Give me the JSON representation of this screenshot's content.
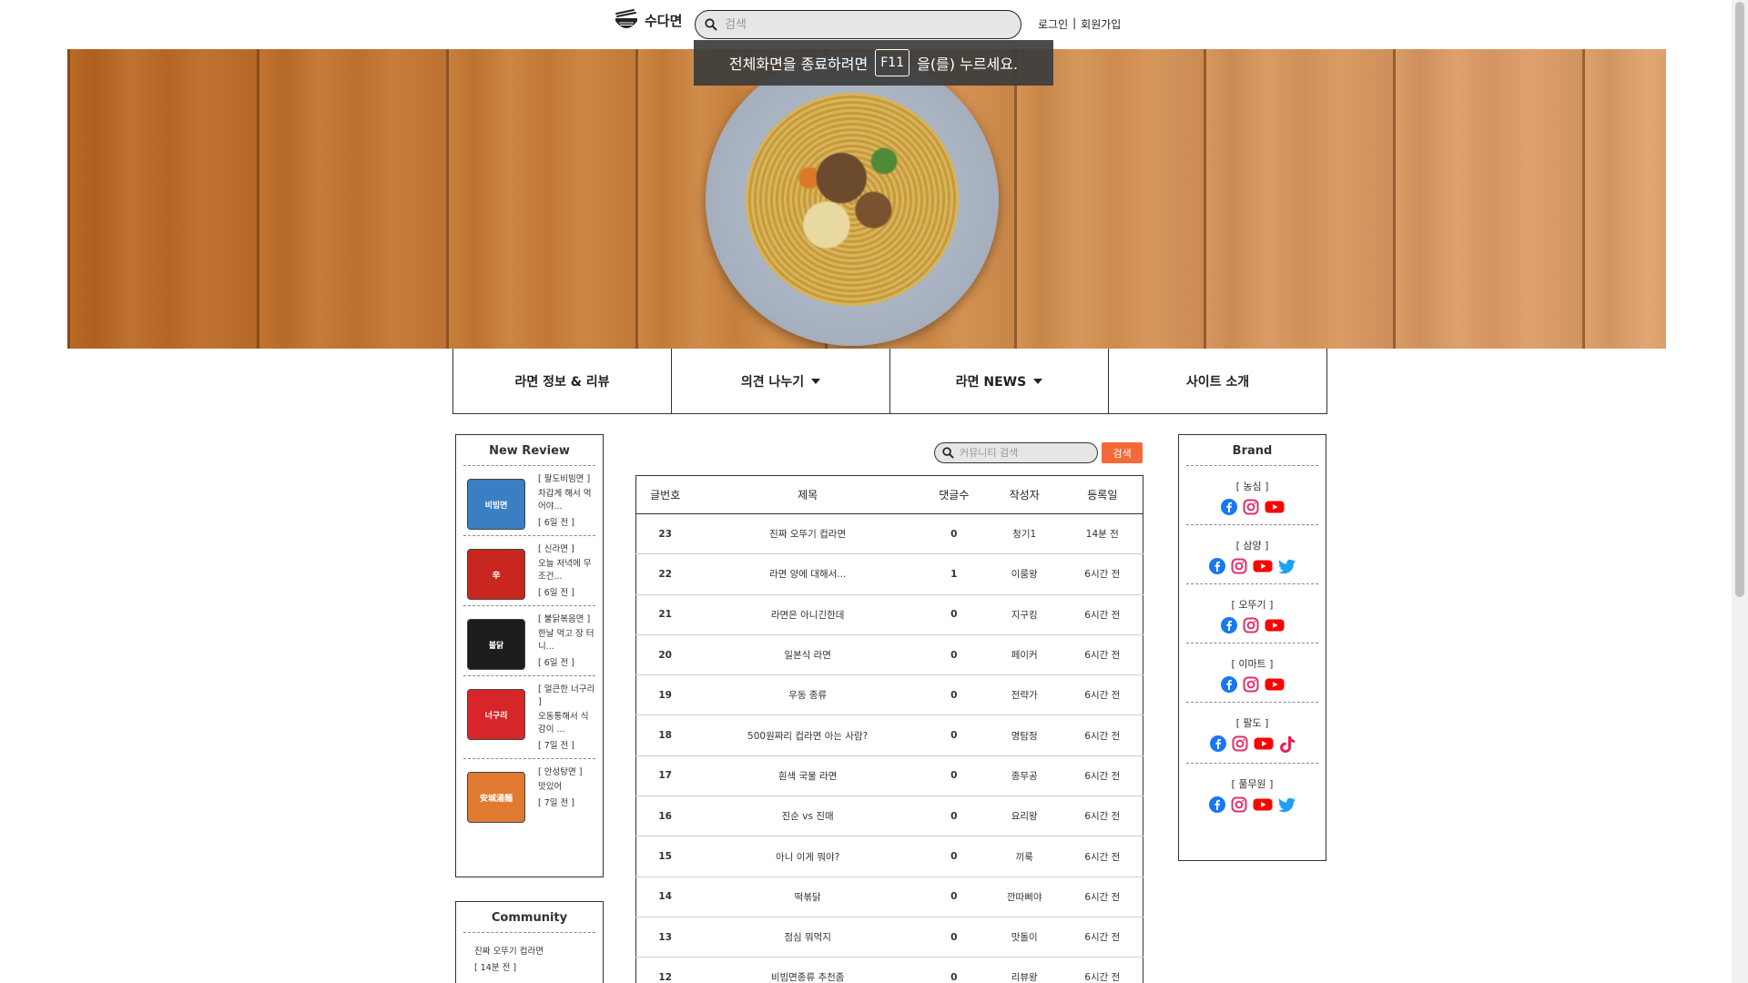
{
  "header": {
    "logo_text": "수다면",
    "search_placeholder": "검색",
    "login": "로그인",
    "separator": "|",
    "signup": "회원가입"
  },
  "toast": {
    "before": "전체화면을 종료하려면",
    "key": "F11",
    "after": "을(를) 누르세요."
  },
  "nav": [
    {
      "label": "라면 정보 & 리뷰",
      "dropdown": false
    },
    {
      "label": "의견 나누기",
      "dropdown": true
    },
    {
      "label": "라면 NEWS",
      "dropdown": true
    },
    {
      "label": "사이트 소개",
      "dropdown": false
    }
  ],
  "new_review": {
    "title": "New Review",
    "items": [
      {
        "product": "[ 팔도비빔면 ]",
        "comment": "차갑게 해서 먹어야...",
        "date": "[ 6일 전 ]",
        "thumb_color": "#3a7fc4",
        "thumb_text": "비빔면"
      },
      {
        "product": "[ 신라면 ]",
        "comment": "오늘 저녁에 무조건...",
        "date": "[ 6일 전 ]",
        "thumb_color": "#c8261e",
        "thumb_text": "辛"
      },
      {
        "product": "[ 불닭볶음면 ]",
        "comment": "한날 먹고 장 터니...",
        "date": "[ 6일 전 ]",
        "thumb_color": "#1c1c1c",
        "thumb_text": "불닭"
      },
      {
        "product": "[ 얼큰한 너구리 ]",
        "comment": "오동통해서 식감이 ...",
        "date": "[ 7일 전 ]",
        "thumb_color": "#d6262a",
        "thumb_text": "너구리"
      },
      {
        "product": "[ 안성탕면 ]",
        "comment": "맛있어",
        "date": "[ 7일 전 ]",
        "thumb_color": "#e07a30",
        "thumb_text": "安城湯麵"
      }
    ]
  },
  "community": {
    "title": "Community",
    "items": [
      {
        "title": "진짜 오뚜기 컵라면",
        "date": "[ 14분 전 ]"
      }
    ]
  },
  "community_search": {
    "placeholder": "커뮤니티 검색",
    "button": "검색"
  },
  "board": {
    "columns": [
      "글번호",
      "제목",
      "댓글수",
      "작성자",
      "등록일"
    ],
    "rows": [
      {
        "no": "23",
        "title": "진짜 오뚜기 컵라면",
        "comments": "0",
        "author": "청기1",
        "date": "14분 전"
      },
      {
        "no": "22",
        "title": "라면 양에 대해서...",
        "comments": "1",
        "author": "이룸왕",
        "date": "6시간 전"
      },
      {
        "no": "21",
        "title": "라면은 아니긴한데",
        "comments": "0",
        "author": "지구킹",
        "date": "6시간 전"
      },
      {
        "no": "20",
        "title": "일본식 라면",
        "comments": "0",
        "author": "페이커",
        "date": "6시간 전"
      },
      {
        "no": "19",
        "title": "우동 종류",
        "comments": "0",
        "author": "전략가",
        "date": "6시간 전"
      },
      {
        "no": "18",
        "title": "500원짜리 컵라면 아는 사람?",
        "comments": "0",
        "author": "명탐정",
        "date": "6시간 전"
      },
      {
        "no": "17",
        "title": "흰색 국물 라면",
        "comments": "0",
        "author": "종무공",
        "date": "6시간 전"
      },
      {
        "no": "16",
        "title": "진순 vs 진매",
        "comments": "0",
        "author": "요리왕",
        "date": "6시간 전"
      },
      {
        "no": "15",
        "title": "아니 이게 뭐야?",
        "comments": "0",
        "author": "끼룩",
        "date": "6시간 전"
      },
      {
        "no": "14",
        "title": "떡볶닭",
        "comments": "0",
        "author": "깐따삐야",
        "date": "6시간 전"
      },
      {
        "no": "13",
        "title": "점심 뭐먹지",
        "comments": "0",
        "author": "맛돌이",
        "date": "6시간 전"
      },
      {
        "no": "12",
        "title": "비빔면종류 추천좀",
        "comments": "0",
        "author": "리뷰왕",
        "date": "6시간 전"
      }
    ]
  },
  "brand": {
    "title": "Brand",
    "groups": [
      {
        "name": "[ 농심 ]",
        "icons": [
          "facebook",
          "instagram",
          "youtube"
        ]
      },
      {
        "name": "[ 삼양 ]",
        "icons": [
          "facebook",
          "instagram",
          "youtube",
          "twitter"
        ]
      },
      {
        "name": "[ 오뚜기 ]",
        "icons": [
          "facebook",
          "instagram",
          "youtube"
        ]
      },
      {
        "name": "[ 이마트 ]",
        "icons": [
          "facebook",
          "instagram",
          "youtube"
        ]
      },
      {
        "name": "[ 팔도 ]",
        "icons": [
          "facebook",
          "instagram",
          "youtube",
          "tiktok"
        ]
      },
      {
        "name": "[ 풀무원 ]",
        "icons": [
          "facebook",
          "instagram",
          "youtube",
          "twitter"
        ]
      }
    ]
  },
  "colors": {
    "accent": "#f4693a",
    "facebook": "#1877f2",
    "instagram": "#e1306c",
    "youtube": "#ff0000",
    "twitter": "#1da1f2",
    "tiktok": "#ee1d52"
  }
}
